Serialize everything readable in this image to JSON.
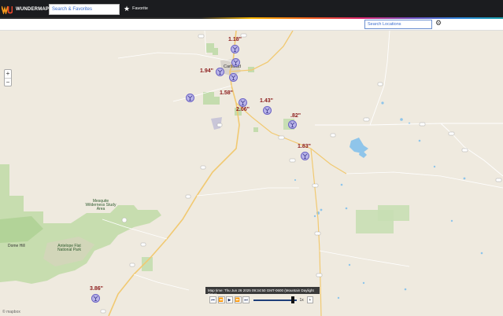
{
  "header": {
    "brand": "WUNDERMAP",
    "search_placeholder": "Search & Favorites",
    "favorite_label": "Favorite"
  },
  "subbar": {
    "location_placeholder": "Search Locations"
  },
  "zoom": {
    "in": "+",
    "out": "−"
  },
  "markers": [
    {
      "label": "1.18\""
    },
    {
      "label": "1.94\""
    },
    {
      "label": "1.58\""
    },
    {
      "label": "2.06\""
    },
    {
      "label": "1.43\""
    },
    {
      "label": ".82\""
    },
    {
      "label": "1.83\""
    },
    {
      "label": "3.86\""
    }
  ],
  "map_labels": {
    "carlsbad": "Carlsbad",
    "wilderness": "Mesquite Wilderness Study Area",
    "dome": "Dome Hill",
    "antelope": "Antelope Flat National Park",
    "mapbox": "© mapbox"
  },
  "time": {
    "text": "Map time: Thu Jun 26 2025 09:34:50 GMT-0600 (Mountain Daylight Time)",
    "speed": "1x",
    "plus": "+",
    "progress_percent": 95
  },
  "controls": [
    "⏮",
    "⏪",
    "▶",
    "⏩",
    "⏭"
  ],
  "colors": {
    "precip_text": "#8b1a1a",
    "marker_fill": "#b9b4e8",
    "topbar": "#1b1c1f"
  }
}
